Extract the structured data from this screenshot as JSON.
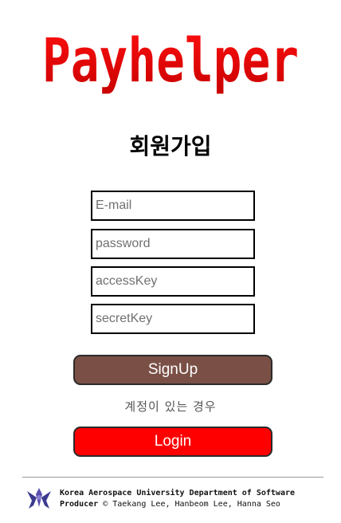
{
  "brand": {
    "name": "Payhelper",
    "color": "#e00000"
  },
  "page": {
    "title": "회원가입"
  },
  "form": {
    "email_placeholder": "E-mail",
    "password_placeholder": "password",
    "access_key_placeholder": "accessKey",
    "secret_key_placeholder": "secretKey",
    "signup_label": "SignUp",
    "account_hint": "계정이 있는 경우",
    "login_label": "Login"
  },
  "colors": {
    "signup_button": "#7a5046",
    "login_button": "#ff0000"
  },
  "footer": {
    "line1": "Korea Aerospace University Department of Software",
    "producer_label": "Producer",
    "line2_rest": " © Taekang Lee, Hanbeom Lee, Hanna Seo",
    "logo_icon": "university-emblem-icon"
  }
}
